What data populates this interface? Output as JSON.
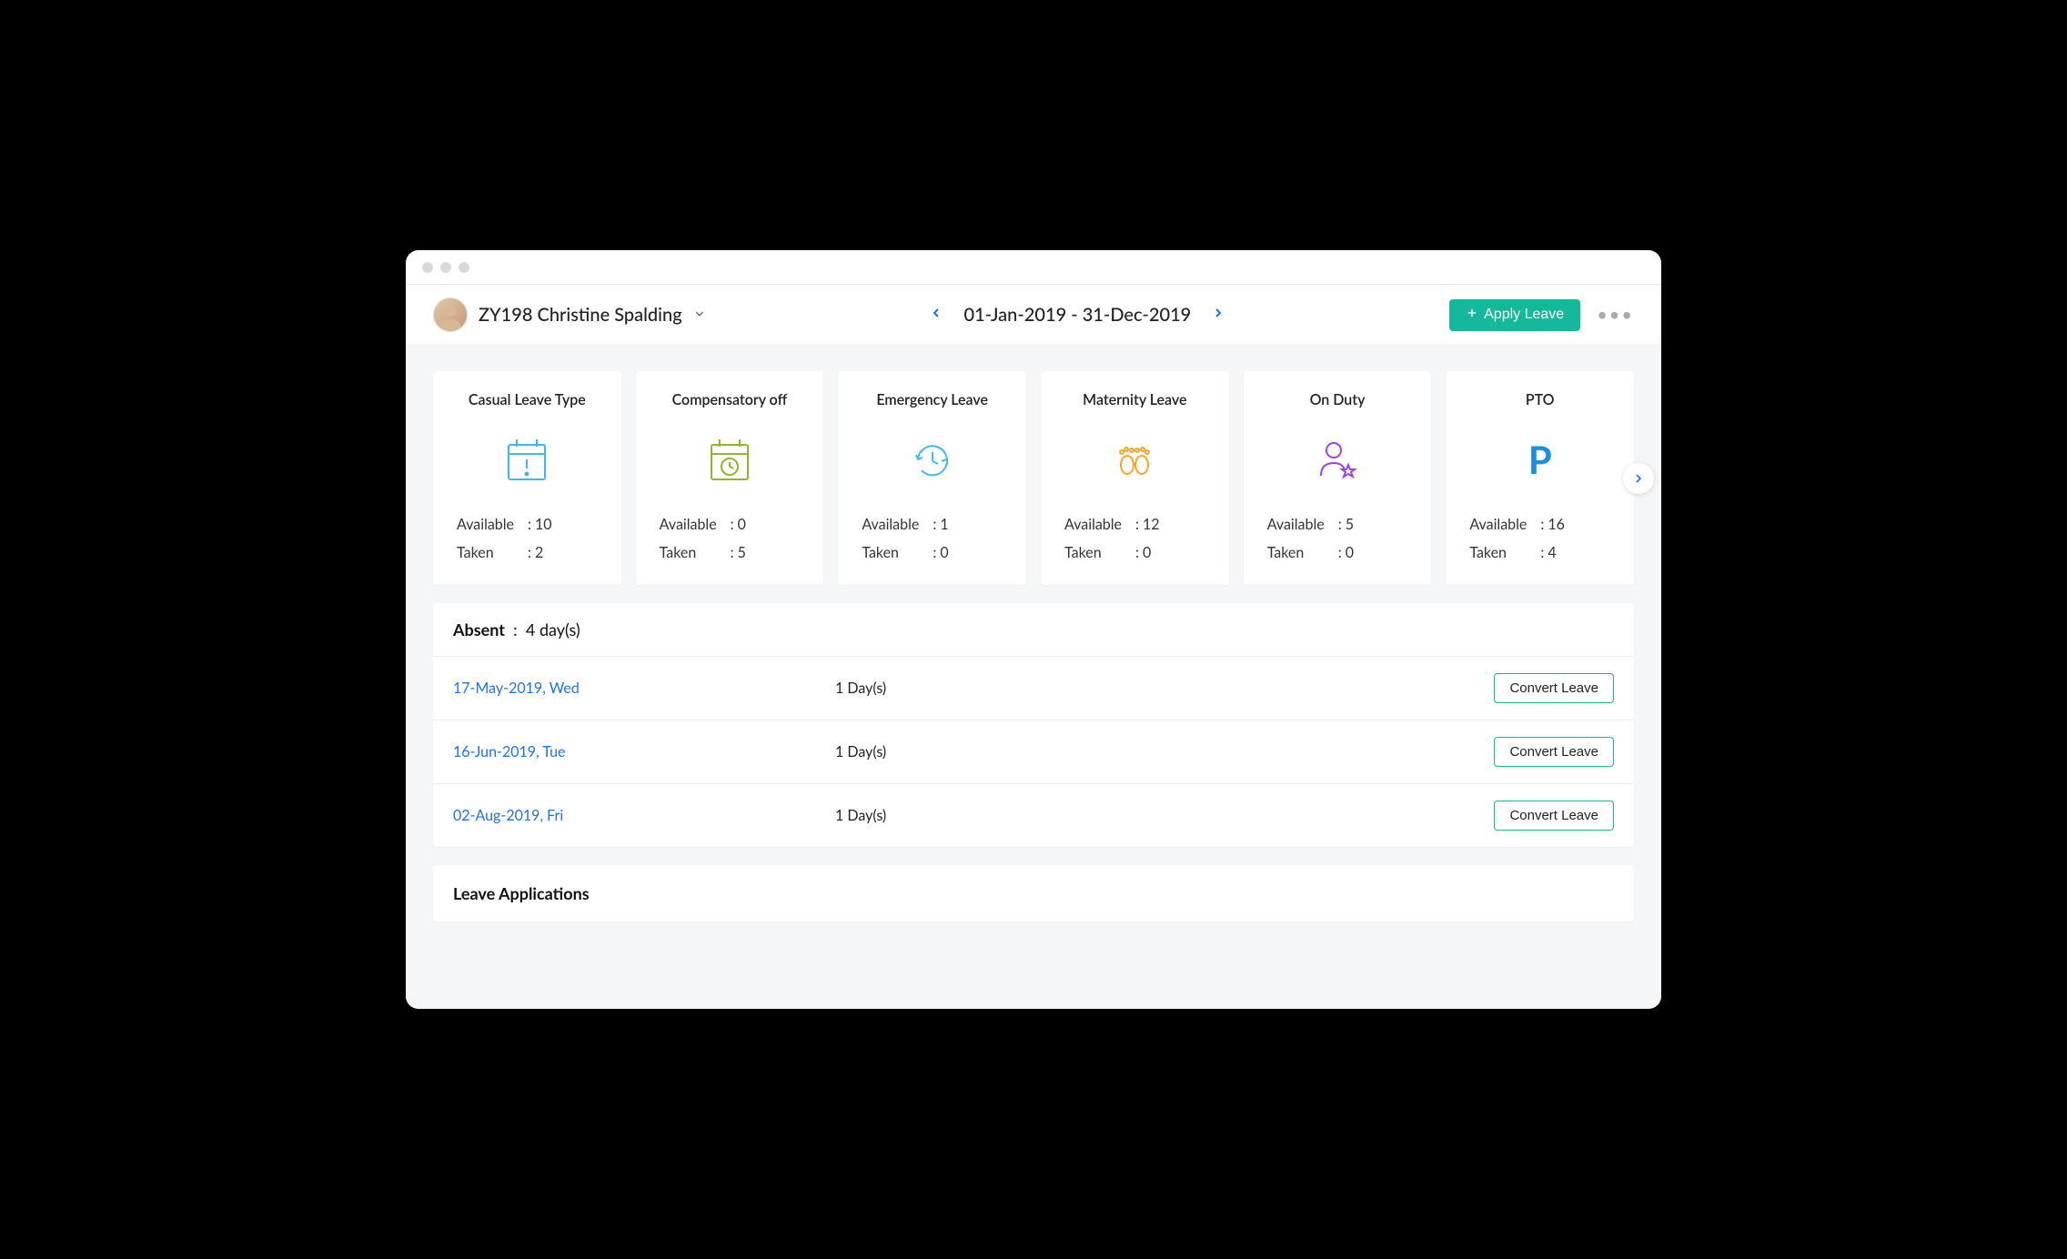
{
  "user": {
    "name": "ZY198 Christine Spalding"
  },
  "dateRange": "01-Jan-2019 - 31-Dec-2019",
  "applyLeaveLabel": "Apply Leave",
  "labels": {
    "available": "Available",
    "taken": "Taken"
  },
  "cards": [
    {
      "title": "Casual Leave Type",
      "available": "10",
      "taken": "2"
    },
    {
      "title": "Compensatory off",
      "available": "0",
      "taken": "5"
    },
    {
      "title": "Emergency Leave",
      "available": "1",
      "taken": "0"
    },
    {
      "title": "Maternity Leave",
      "available": "12",
      "taken": "0"
    },
    {
      "title": "On Duty",
      "available": "5",
      "taken": "0"
    },
    {
      "title": "PTO",
      "available": "16",
      "taken": "4"
    }
  ],
  "absent": {
    "heading": "Absent",
    "total": "4 day(s)",
    "rows": [
      {
        "date": "17-May-2019, Wed",
        "duration": "1 Day(s)",
        "action": "Convert Leave"
      },
      {
        "date": "16-Jun-2019, Tue",
        "duration": "1 Day(s)",
        "action": "Convert Leave"
      },
      {
        "date": "02-Aug-2019, Fri",
        "duration": "1 Day(s)",
        "action": "Convert Leave"
      }
    ]
  },
  "applications": {
    "heading": "Leave Applications"
  }
}
